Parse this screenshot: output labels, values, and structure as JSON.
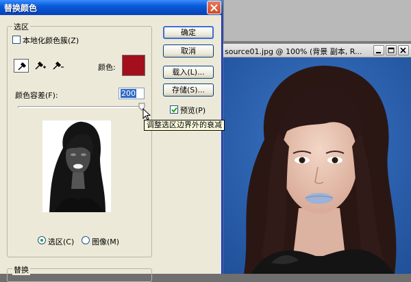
{
  "dialog": {
    "title": "替换颜色",
    "selection_group": {
      "label": "选区",
      "localized_clusters_label": "本地化颜色簇(Z)",
      "localized_clusters_checked": false,
      "color_label": "颜色:",
      "selected_color": "#a30f1c",
      "tolerance_label": "颜色容差(F):",
      "tolerance_value": "200",
      "tolerance_fraction": 1.0,
      "view_options": [
        {
          "label": "选区(C)",
          "selected": true
        },
        {
          "label": "图像(M)",
          "selected": false
        }
      ]
    },
    "replace_group": {
      "label": "替换"
    },
    "buttons": {
      "ok": "确定",
      "cancel": "取消",
      "load": "载入(L)...",
      "save": "存储(S)..."
    },
    "preview": {
      "label": "预览(P)",
      "checked": true
    },
    "tooltip": "调整选区边界外的衰减"
  },
  "document": {
    "title": "source01.jpg @ 100% (背景 副本, R...",
    "background_color": "#2f63b0"
  },
  "colors": {
    "titlebar_blue": "#0a5bd8",
    "dialog_bg": "#ece9d8",
    "close_red": "#d14b25"
  }
}
